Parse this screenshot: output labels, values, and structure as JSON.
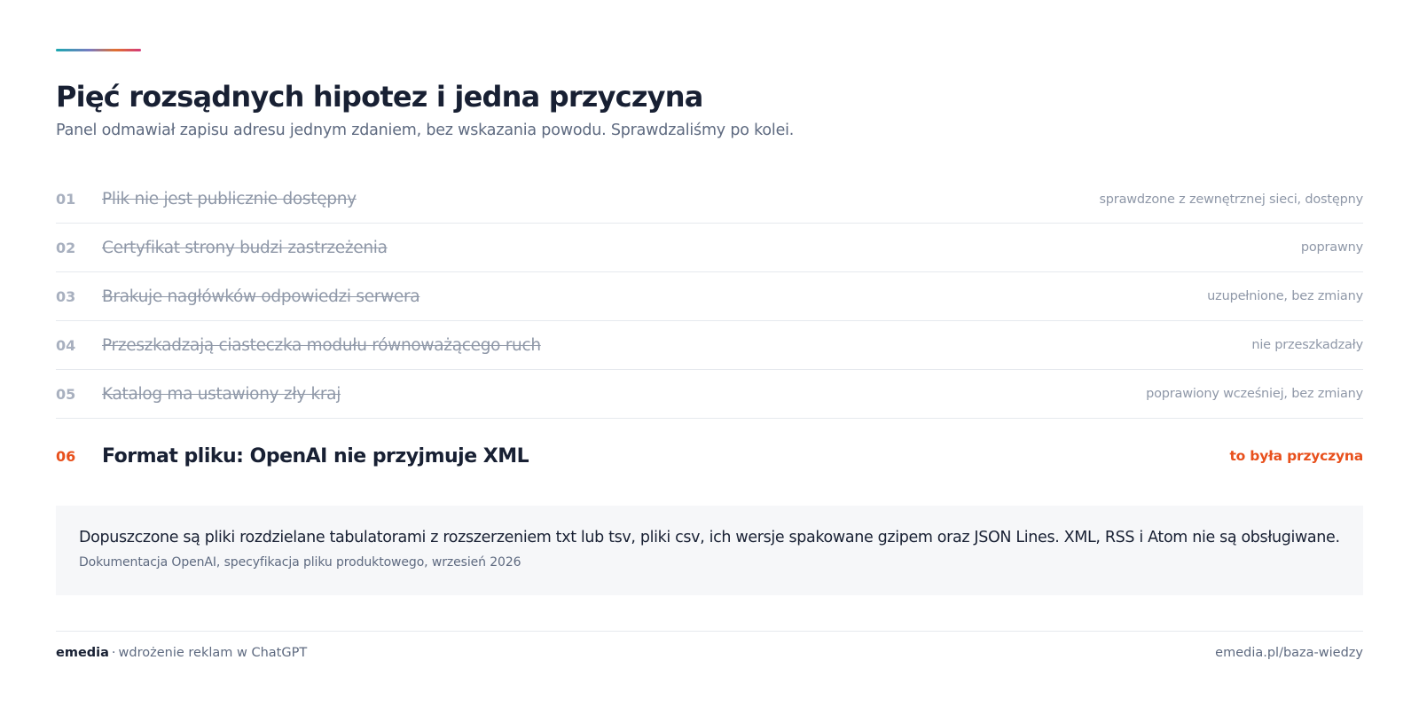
{
  "header": {
    "title": "Pięć rozsądnych hipotez i jedna przyczyna",
    "subtitle": "Panel odmawiał zapisu adresu jednym zdaniem, bez wskazania powodu. Sprawdzaliśmy po kolei."
  },
  "hypotheses": [
    {
      "num": "01",
      "text": "Plik nie jest publicznie dostępny",
      "status": "sprawdzone z zewnętrznej sieci, dostępny"
    },
    {
      "num": "02",
      "text": "Certyfikat strony budzi zastrzeżenia",
      "status": "poprawny"
    },
    {
      "num": "03",
      "text": "Brakuje nagłówków odpowiedzi serwera",
      "status": "uzupełnione, bez zmiany"
    },
    {
      "num": "04",
      "text": "Przeszkadzają ciasteczka modułu równoważącego ruch",
      "status": "nie przeszkadzały"
    },
    {
      "num": "05",
      "text": "Katalog ma ustawiony zły kraj",
      "status": "poprawiony wcześniej, bez zmiany"
    }
  ],
  "cause": {
    "num": "06",
    "text": "Format pliku: OpenAI nie przyjmuje XML",
    "status": "to była przyczyna"
  },
  "quote": {
    "text": "Dopuszczone są pliki rozdzielane tabulatorami z rozszerzeniem txt lub tsv, pliki csv, ich wersje spakowane gzipem oraz JSON Lines. XML, RSS i Atom nie są obsługiwane.",
    "source": "Dokumentacja OpenAI, specyfikacja pliku produktowego, wrzesień 2026"
  },
  "footer": {
    "brand": "emedia",
    "separator": "·",
    "tagline": "wdrożenie reklam w ChatGPT",
    "url": "emedia.pl/baza-wiedzy"
  },
  "colors": {
    "accent": "#e8501c",
    "heading": "#182033",
    "muted": "#8f98a8"
  }
}
